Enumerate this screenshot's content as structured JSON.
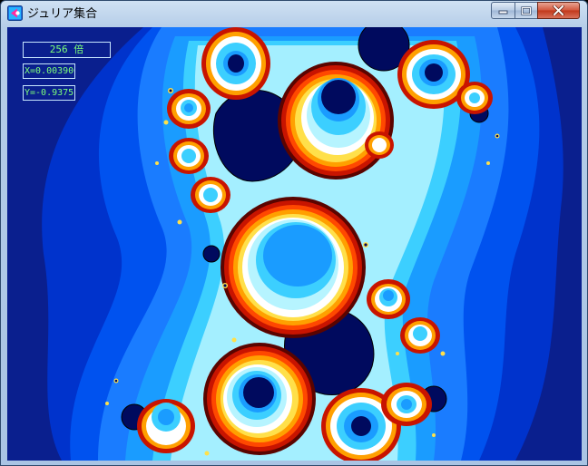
{
  "window": {
    "title": "ジュリア集合",
    "controls": {
      "minimize": "minimize-icon",
      "maximize": "maximize-icon",
      "close": "close-icon"
    }
  },
  "hud": {
    "zoom": "256 倍",
    "x": "X=0.003906",
    "y": "Y=-0.9375"
  },
  "colors": {
    "title_bar": "#b9d1ea",
    "client_background": "#0a1f8e",
    "hud_text": "#7dff7a",
    "hud_border": "#c8e6ff",
    "fractal_palette": [
      "#000a5e",
      "#0a1f8e",
      "#0033cc",
      "#0066ff",
      "#1a9cff",
      "#3ccfff",
      "#b6f4ff",
      "#ffffff",
      "#ffe04a",
      "#ffa000",
      "#ff4800",
      "#c81400",
      "#5a0400"
    ]
  }
}
